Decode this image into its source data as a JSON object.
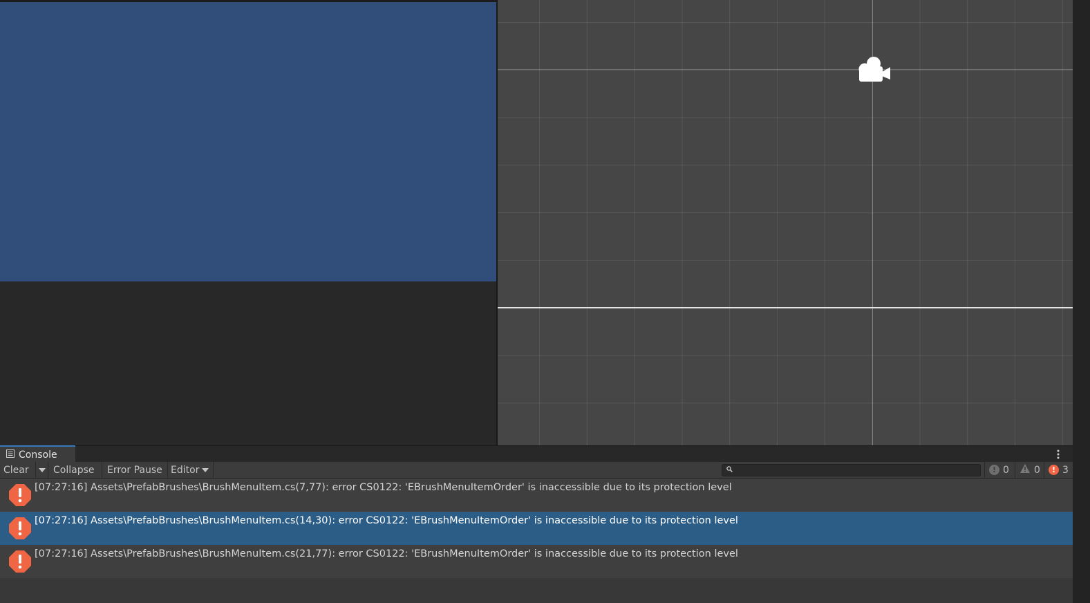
{
  "console": {
    "tab_label": "Console",
    "toolbar": {
      "clear_label": "Clear",
      "collapse_label": "Collapse",
      "error_pause_label": "Error Pause",
      "editor_label": "Editor",
      "search_placeholder": "",
      "info_count": "0",
      "warning_count": "0",
      "error_count": "3"
    },
    "entries": [
      {
        "type": "error",
        "text": "[07:27:16] Assets\\PrefabBrushes\\BrushMenuItem.cs(7,77): error CS0122: 'EBrushMenuItemOrder' is inaccessible due to its protection level",
        "selected": false
      },
      {
        "type": "error",
        "text": "[07:27:16] Assets\\PrefabBrushes\\BrushMenuItem.cs(14,30): error CS0122: 'EBrushMenuItemOrder' is inaccessible due to its protection level",
        "selected": true
      },
      {
        "type": "error",
        "text": "[07:27:16] Assets\\PrefabBrushes\\BrushMenuItem.cs(21,77): error CS0122: 'EBrushMenuItemOrder' is inaccessible due to its protection level",
        "selected": false
      }
    ]
  },
  "icons": {
    "console_tab": "console-icon",
    "menu": "kebab-menu-icon",
    "search": "search-icon",
    "scene_camera": "camera-gizmo-icon",
    "error": "error-icon",
    "warning": "warning-icon",
    "info": "info-icon"
  },
  "colors": {
    "camera_background": "#314d79",
    "selection": "#2c5d87",
    "error_icon": "#f06543",
    "tab_accent": "#3a79bb"
  }
}
